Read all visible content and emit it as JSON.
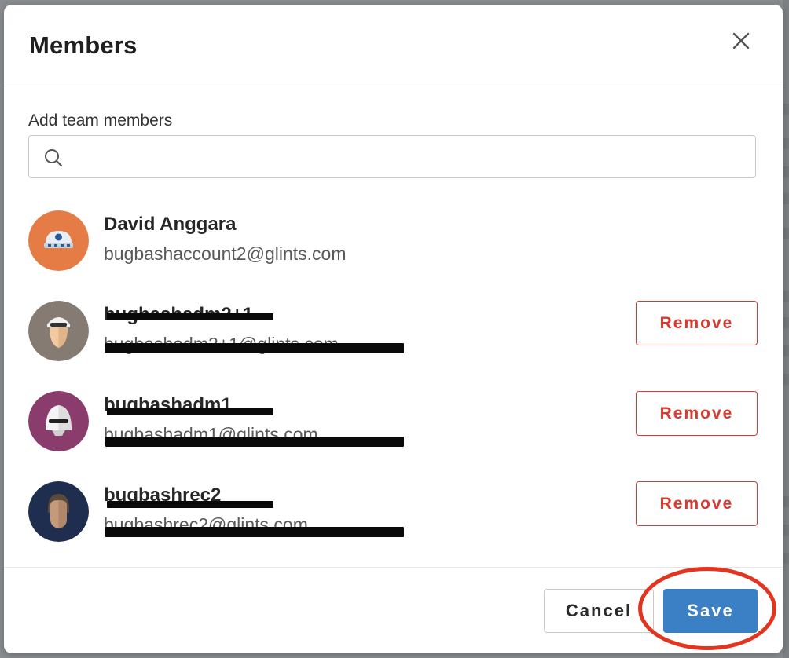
{
  "dialog": {
    "title": "Members",
    "close_icon": "close-icon"
  },
  "search": {
    "label": "Add team members",
    "value": "",
    "placeholder": "",
    "icon": "search-icon"
  },
  "members": [
    {
      "name": "David Anggara",
      "email": "bugbashaccount2@glints.com",
      "avatar_color": "#e57c45",
      "removable": false
    },
    {
      "name": "bugbashadm2+1",
      "email": "bugbashadm2+1@glints.com",
      "avatar_color": "#857b73",
      "removable": true,
      "redacted": true,
      "remove_label": "Remove"
    },
    {
      "name": "bugbashadm1",
      "email": "bugbashadm1@glints.com",
      "avatar_color": "#8a3d6c",
      "removable": true,
      "redacted": true,
      "remove_label": "Remove"
    },
    {
      "name": "bugbashrec2",
      "email": "bugbashrec2@glints.com",
      "avatar_color": "#1f2d4f",
      "removable": true,
      "redacted": true,
      "remove_label": "Remove"
    }
  ],
  "footer": {
    "cancel_label": "Cancel",
    "save_label": "Save"
  },
  "colors": {
    "primary": "#3b7fc4",
    "danger": "#d93a30",
    "annotation": "#e2341f"
  }
}
